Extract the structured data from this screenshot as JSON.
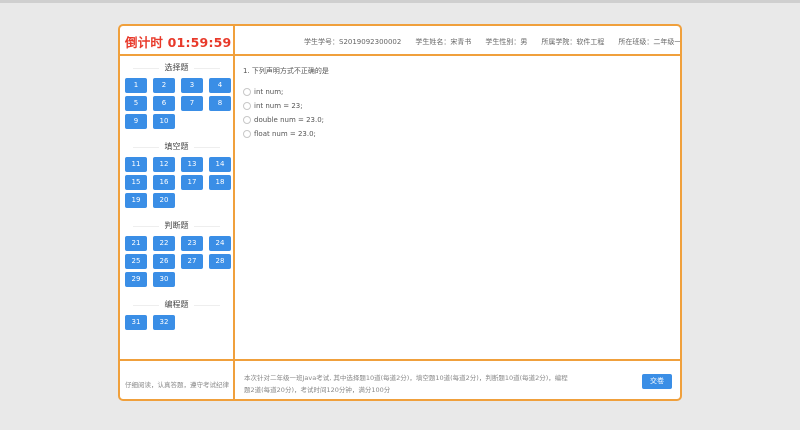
{
  "header": {
    "timer": "倒计时 01:59:59",
    "student_id": "学生学号：S2019092300002",
    "student_name": "学生姓名：宋青书",
    "student_gender": "学生性别：男",
    "student_college": "所属学院：软件工程",
    "student_class": "所在班级：二年级一班"
  },
  "sidebar": {
    "sections": [
      {
        "title": "选择题",
        "buttons": [
          "1",
          "2",
          "3",
          "4",
          "5",
          "6",
          "7",
          "8",
          "9",
          "10"
        ]
      },
      {
        "title": "填空题",
        "buttons": [
          "11",
          "12",
          "13",
          "14",
          "15",
          "16",
          "17",
          "18",
          "19",
          "20"
        ]
      },
      {
        "title": "判断题",
        "buttons": [
          "21",
          "22",
          "23",
          "24",
          "25",
          "26",
          "27",
          "28",
          "29",
          "30"
        ]
      },
      {
        "title": "编程题",
        "buttons": [
          "31",
          "32"
        ]
      }
    ]
  },
  "question": {
    "text": "1. 下列声明方式不正确的是",
    "options": [
      "int num;",
      "int num = 23;",
      "double num = 23.0;",
      "float num = 23.0;"
    ]
  },
  "footer": {
    "notice": "仔细阅读，认真答题，遵守考试纪律",
    "description": "本次针对二年级一班Java考试, 其中选择题10道(每道2分)，填空题10道(每道2分)，判断题10道(每道2分)，编程题2道(每道20分)，考试时间120分钟，满分100分",
    "submit_label": "交卷"
  },
  "colors": {
    "accent_border": "#f0a03c",
    "button_blue": "#3a8ee6",
    "timer_red": "#e8392a"
  }
}
